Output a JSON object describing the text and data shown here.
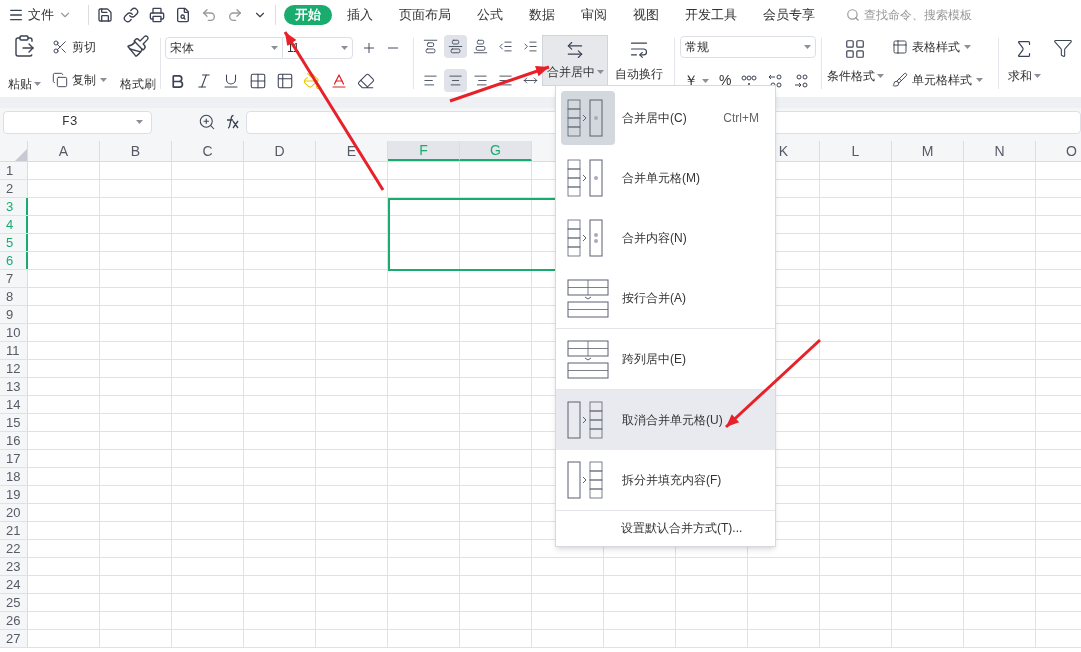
{
  "file_menu": {
    "label": "文件"
  },
  "tabs": [
    {
      "label": "开始",
      "selected": true
    },
    {
      "label": "插入",
      "selected": false
    },
    {
      "label": "页面布局",
      "selected": false
    },
    {
      "label": "公式",
      "selected": false
    },
    {
      "label": "数据",
      "selected": false
    },
    {
      "label": "审阅",
      "selected": false
    },
    {
      "label": "视图",
      "selected": false
    },
    {
      "label": "开发工具",
      "selected": false
    },
    {
      "label": "会员专享",
      "selected": false
    }
  ],
  "search": {
    "placeholder": "查找命令、搜索模板"
  },
  "ribbon": {
    "paste": "粘贴",
    "cut": "剪切",
    "copy": "复制",
    "format_painter": "格式刷",
    "font_name": "宋体",
    "font_size": "11",
    "align_top_row": [
      {
        "kind": "top",
        "selected": false
      },
      {
        "kind": "middle",
        "selected": true
      },
      {
        "kind": "bottom",
        "selected": false
      },
      {
        "kind": "outdent",
        "selected": false
      },
      {
        "kind": "indent",
        "selected": false
      }
    ],
    "align_bottom_row": [
      {
        "kind": "left",
        "selected": false
      },
      {
        "kind": "center",
        "selected": true
      },
      {
        "kind": "right",
        "selected": false
      },
      {
        "kind": "justify",
        "selected": false
      },
      {
        "kind": "distribute",
        "selected": false
      }
    ],
    "merge_button": {
      "label": "合并居中",
      "pressed": true
    },
    "wrap": "自动换行",
    "number_format": "常规",
    "currency": "￥",
    "percent": "%",
    "conditional": "条件格式",
    "table_style": "表格样式",
    "cell_style": "单元格样式",
    "sum": "求和"
  },
  "name_box": "F3",
  "sheet": {
    "columns": [
      {
        "label": "A",
        "selected": false
      },
      {
        "label": "B",
        "selected": false
      },
      {
        "label": "C",
        "selected": false
      },
      {
        "label": "D",
        "selected": false
      },
      {
        "label": "E",
        "selected": false
      },
      {
        "label": "F",
        "selected": true
      },
      {
        "label": "G",
        "selected": true
      },
      {
        "label": "K",
        "selected": false
      },
      {
        "label": "L",
        "selected": false
      },
      {
        "label": "M",
        "selected": false
      },
      {
        "label": "N",
        "selected": false
      },
      {
        "label": "O",
        "selected": false
      }
    ],
    "rows": [
      {
        "label": "1",
        "selected": false
      },
      {
        "label": "2",
        "selected": false
      },
      {
        "label": "3",
        "selected": true
      },
      {
        "label": "4",
        "selected": true
      },
      {
        "label": "5",
        "selected": true
      },
      {
        "label": "6",
        "selected": true
      },
      {
        "label": "7",
        "selected": false
      },
      {
        "label": "8",
        "selected": false
      },
      {
        "label": "9",
        "selected": false
      },
      {
        "label": "10",
        "selected": false
      },
      {
        "label": "11",
        "selected": false
      },
      {
        "label": "12",
        "selected": false
      },
      {
        "label": "13",
        "selected": false
      },
      {
        "label": "14",
        "selected": false
      },
      {
        "label": "15",
        "selected": false
      },
      {
        "label": "16",
        "selected": false
      },
      {
        "label": "17",
        "selected": false
      },
      {
        "label": "18",
        "selected": false
      },
      {
        "label": "19",
        "selected": false
      },
      {
        "label": "20",
        "selected": false
      },
      {
        "label": "21",
        "selected": false
      },
      {
        "label": "22",
        "selected": false
      },
      {
        "label": "23",
        "selected": false
      },
      {
        "label": "24",
        "selected": false
      },
      {
        "label": "25",
        "selected": false
      },
      {
        "label": "26",
        "selected": false
      },
      {
        "label": "27",
        "selected": false
      }
    ]
  },
  "merge_menu": {
    "groups": [
      [
        {
          "kind": "merge-center",
          "label": "合并居中(C)",
          "shortcut": "Ctrl+M",
          "selected": true,
          "highlighted": false
        },
        {
          "kind": "merge-cells",
          "label": "合并单元格(M)",
          "selected": false,
          "highlighted": false
        },
        {
          "kind": "merge-content",
          "label": "合并内容(N)",
          "selected": false,
          "highlighted": false
        },
        {
          "kind": "merge-rows",
          "label": "按行合并(A)",
          "selected": false,
          "highlighted": false
        }
      ],
      [
        {
          "kind": "center-across",
          "label": "跨列居中(E)",
          "selected": false,
          "highlighted": false
        }
      ],
      [
        {
          "kind": "unmerge",
          "label": "取消合并单元格(U)",
          "selected": false,
          "highlighted": true
        },
        {
          "kind": "split-fill",
          "label": "拆分并填充内容(F)",
          "selected": false,
          "highlighted": false
        }
      ],
      [
        {
          "kind": "text",
          "label": "设置默认合并方式(T)...",
          "highlighted": false
        }
      ]
    ]
  }
}
